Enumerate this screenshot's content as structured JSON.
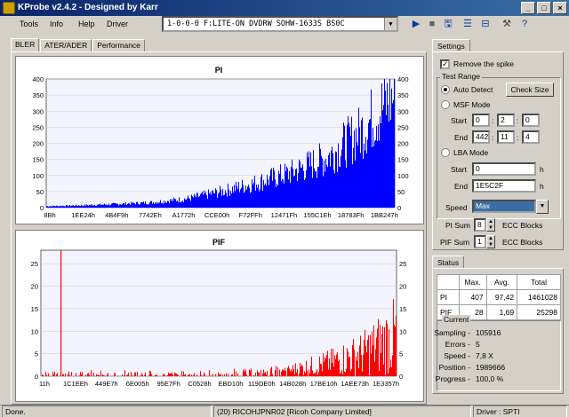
{
  "window": {
    "title": "KProbe v2.4.2 - Designed by Karr"
  },
  "menu": {
    "tools": "Tools",
    "info": "Info",
    "help": "Help",
    "driver": "Driver"
  },
  "drive": {
    "selected": "1-0-0-0 F:LITE-ON DVDRW SOHW-1633S BS0C"
  },
  "tabs": [
    "BLER",
    "ATER/ADER",
    "Performance"
  ],
  "charts": {
    "pi": {
      "title": "PI",
      "y_ticks": [
        "400",
        "350",
        "300",
        "250",
        "200",
        "150",
        "100",
        "50",
        "0"
      ],
      "x_ticks": [
        "8Bh",
        "1EE24h",
        "4B4F9h",
        "7742Eh",
        "A1772h",
        "CCE00h",
        "F72FFh",
        "12471Fh",
        "155C1Eh",
        "18783Fh",
        "1BB247h"
      ],
      "bar_color": "#0000ff"
    },
    "pif": {
      "title": "PIF",
      "y_ticks": [
        "25",
        "20",
        "15",
        "10",
        "5",
        "0"
      ],
      "x_ticks": [
        "11h",
        "1C1EEh",
        "449E7h",
        "6E005h",
        "95E7Fh",
        "C0528h",
        "EBD10h",
        "119DE0h",
        "14B028h",
        "17BE10h",
        "1AEE73h",
        "1E3357h"
      ],
      "bar_color": "#ff0000"
    }
  },
  "chart_data": [
    {
      "type": "bar",
      "title": "PI",
      "ylim": [
        0,
        400
      ],
      "x_ticks": [
        "8Bh",
        "1EE24h",
        "4B4F9h",
        "7742Eh",
        "A1772h",
        "CCE00h",
        "F72FFh",
        "12471Fh",
        "155C1Eh",
        "18783Fh",
        "1BB247h"
      ],
      "profile": [
        {
          "x_fraction": 0.0,
          "y": 5
        },
        {
          "x_fraction": 0.1,
          "y": 8
        },
        {
          "x_fraction": 0.2,
          "y": 12
        },
        {
          "x_fraction": 0.3,
          "y": 18
        },
        {
          "x_fraction": 0.4,
          "y": 30
        },
        {
          "x_fraction": 0.5,
          "y": 55
        },
        {
          "x_fraction": 0.6,
          "y": 85
        },
        {
          "x_fraction": 0.7,
          "y": 120
        },
        {
          "x_fraction": 0.8,
          "y": 170
        },
        {
          "x_fraction": 0.9,
          "y": 260
        },
        {
          "x_fraction": 0.95,
          "y": 330
        },
        {
          "x_fraction": 1.0,
          "y": 390
        }
      ]
    },
    {
      "type": "bar",
      "title": "PIF",
      "ylim": [
        0,
        28
      ],
      "x_ticks": [
        "11h",
        "1C1EEh",
        "449E7h",
        "6E005h",
        "95E7Fh",
        "C0528h",
        "EBD10h",
        "119DE0h",
        "14B028h",
        "17BE10h",
        "1AEE73h",
        "1E3357h"
      ],
      "profile": [
        {
          "x_fraction": 0.0,
          "y": 1
        },
        {
          "x_fraction": 0.5,
          "y": 1
        },
        {
          "x_fraction": 0.7,
          "y": 2
        },
        {
          "x_fraction": 0.8,
          "y": 4
        },
        {
          "x_fraction": 0.9,
          "y": 7
        },
        {
          "x_fraction": 1.0,
          "y": 13
        }
      ],
      "spike": {
        "x_fraction": 0.055,
        "y": 28
      }
    }
  ],
  "settings": {
    "tab": "Settings",
    "remove_spike": "Remove the spike",
    "test_range": "Test Range",
    "auto_detect": "Auto Detect",
    "check_size": "Check Size",
    "msf_mode": "MSF Mode",
    "start": "Start",
    "end": "End",
    "msf_start": [
      "0",
      "2",
      "0"
    ],
    "msf_end": [
      "442",
      "11",
      "4"
    ],
    "lba_mode": "LBA Mode",
    "lba_start": "0",
    "lba_end": "1E5C2F",
    "h": "h",
    "speed_label": "Speed",
    "speed_value": "Max",
    "pi_sum": "PI Sum",
    "pi_sum_value": "8",
    "pif_sum": "PIF Sum",
    "pif_sum_value": "1",
    "ecc_blocks": "ECC Blocks"
  },
  "status": {
    "tab": "Status",
    "headers": [
      "",
      "Max.",
      "Avg.",
      "Total"
    ],
    "rows": [
      {
        "label": "PI",
        "max": "407",
        "avg": "97,42",
        "total": "1461028"
      },
      {
        "label": "PIF",
        "max": "28",
        "avg": "1,69",
        "total": "25298"
      }
    ],
    "current": "Current",
    "sampling_label": "Sampling -",
    "sampling": "105916",
    "errors_label": "Errors -",
    "errors": "5",
    "speed_label": "Speed -",
    "speed": "7,8  X",
    "position_label": "Position -",
    "position": "1989666",
    "progress_label": "Progress -",
    "progress": "100,0 %"
  },
  "statusbar": {
    "left": "Done.",
    "center": "(20) RICOHJPNR02 [Ricoh Company Limited]",
    "right": "Driver : SPTI"
  }
}
